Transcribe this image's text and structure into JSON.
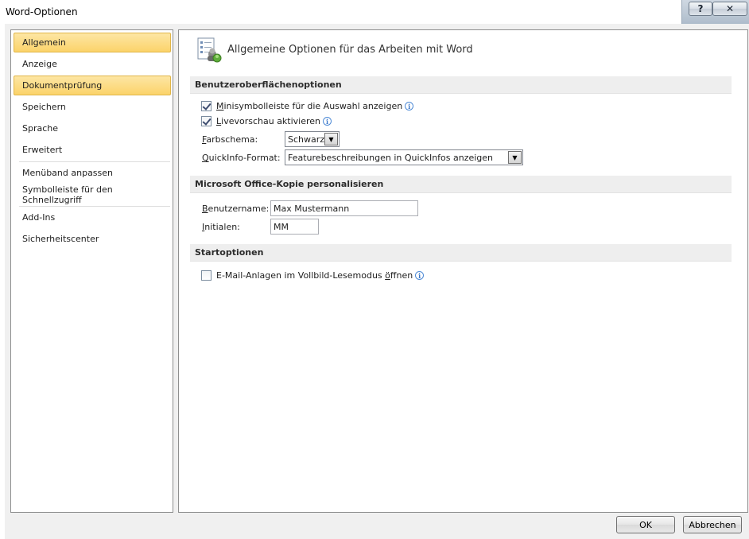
{
  "window": {
    "title": "Word-Optionen",
    "help_label": "?",
    "close_label": "✕"
  },
  "sidebar": {
    "items": [
      {
        "label": "Allgemein",
        "active": true
      },
      {
        "label": "Anzeige"
      },
      {
        "label": "Dokumentprüfung",
        "active": true
      },
      {
        "label": "Speichern"
      },
      {
        "label": "Sprache"
      },
      {
        "label": "Erweitert"
      },
      {
        "label": "Menüband anpassen"
      },
      {
        "label": "Symbolleiste für den Schnellzugriff"
      },
      {
        "label": "Add-Ins"
      },
      {
        "label": "Sicherheitscenter"
      }
    ]
  },
  "main": {
    "title": "Allgemeine Optionen für das Arbeiten mit Word",
    "ui_section": {
      "header": "Benutzeroberflächenoptionen",
      "mini_toolbar": {
        "label_accel": "M",
        "label_rest": "inisymbolleiste für die Auswahl anzeigen",
        "checked": true
      },
      "live_preview": {
        "label_accel": "L",
        "label_rest": "ivevorschau aktivieren",
        "checked": true
      },
      "color_scheme": {
        "label_accel": "F",
        "label_rest": "arbschema:",
        "value": "Schwarz"
      },
      "tooltip_format": {
        "label_accel": "Q",
        "label_rest": "uickInfo-Format:",
        "value": "Featurebeschreibungen in QuickInfos anzeigen"
      }
    },
    "personalize_section": {
      "header": "Microsoft Office-Kopie personalisieren",
      "username": {
        "label_accel": "B",
        "label_rest": "enutzername:",
        "value": "Max Mustermann"
      },
      "initials": {
        "label_accel": "I",
        "label_rest": "nitialen:",
        "value": "MM"
      }
    },
    "startup_section": {
      "header": "Startoptionen",
      "email_attachments": {
        "label_pre": "E-Mail-Anlagen im Vollbild-Lesemodus ",
        "label_accel": "ö",
        "label_post": "ffnen",
        "checked": false
      }
    }
  },
  "buttons": {
    "ok": "OK",
    "cancel": "Abbrechen"
  },
  "colors": {
    "active_nav": "#fbd36a",
    "section_bg": "#eeeeee",
    "info_blue": "#3a77c9"
  },
  "icons": {
    "info": "info-icon",
    "check": "checkmark",
    "dropdown": "chevron-down-icon",
    "general_options": "general-options-icon"
  }
}
